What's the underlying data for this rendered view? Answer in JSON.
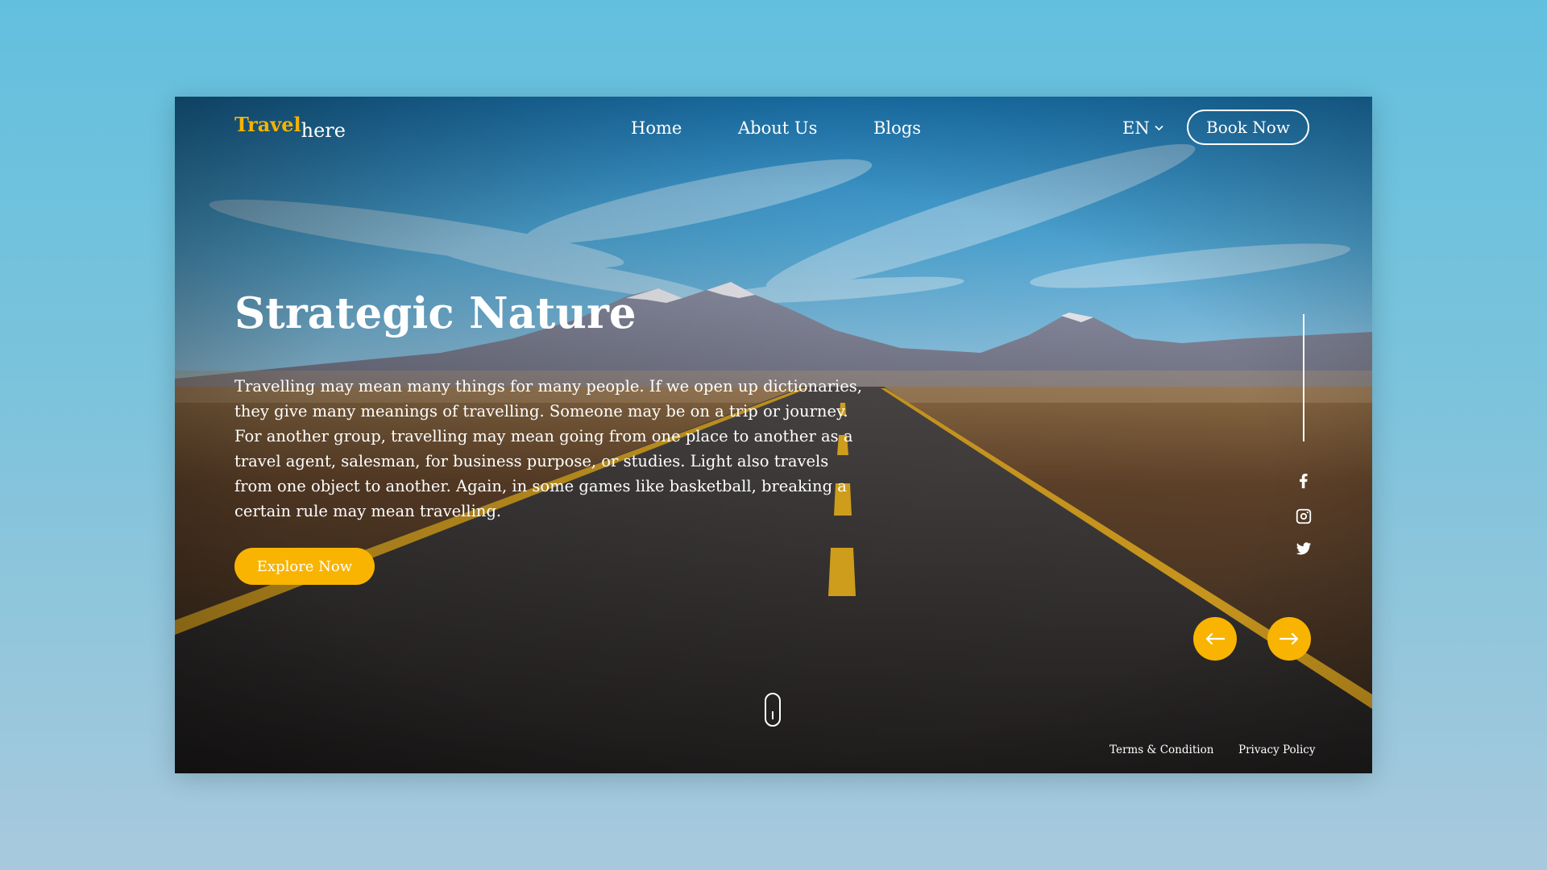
{
  "header": {
    "logo": {
      "part1": "Travel",
      "part2": "here"
    },
    "nav": [
      {
        "label": "Home"
      },
      {
        "label": "About Us"
      },
      {
        "label": "Blogs"
      }
    ],
    "language": "EN",
    "book_label": "Book Now"
  },
  "hero": {
    "title": "Strategic Nature",
    "text": "Travelling may mean many things for many people. If we open up dictionaries, they give many meanings of travelling. Someone may be on a trip or journey. For another group, travelling may mean going from one place to another as a travel agent, salesman, for business purpose, or studies. Light also travels from one object to another. Again, in some games like basketball, breaking a certain rule may mean travelling.",
    "cta_label": "Explore Now"
  },
  "social": [
    {
      "icon": "facebook-icon"
    },
    {
      "icon": "instagram-icon"
    },
    {
      "icon": "twitter-icon"
    }
  ],
  "carousel": {
    "prev_icon": "arrow-left-icon",
    "next_icon": "arrow-right-icon"
  },
  "footer": {
    "links": [
      {
        "label": "Terms & Condition"
      },
      {
        "label": "Privacy Policy"
      }
    ]
  },
  "colors": {
    "accent": "#f8b400",
    "page_background": "#62c0de",
    "text": "#ffffff"
  }
}
